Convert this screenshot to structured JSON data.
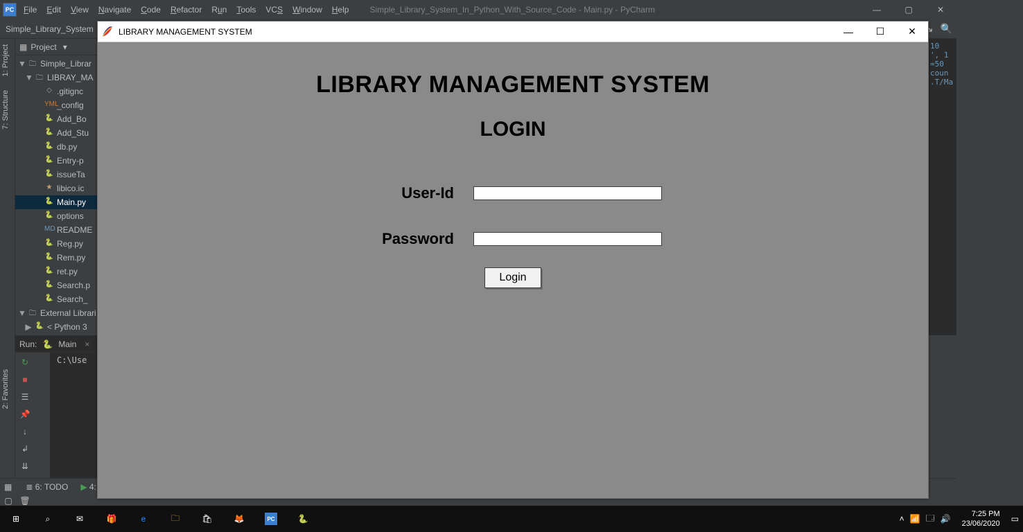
{
  "pycharm": {
    "menu": [
      "File",
      "Edit",
      "View",
      "Navigate",
      "Code",
      "Refactor",
      "Run",
      "Tools",
      "VCS",
      "Window",
      "Help"
    ],
    "window_title": "Simple_Library_System_In_Python_With_Source_Code - Main.py - PyCharm",
    "navbar_crumb": "Simple_Library_System",
    "project": {
      "header": "Project",
      "tree": [
        {
          "depth": 0,
          "exp": "▼",
          "icon": "fld",
          "label": "Simple_Librar"
        },
        {
          "depth": 1,
          "exp": "▼",
          "icon": "fld",
          "label": "LIBRAY_MA"
        },
        {
          "depth": 2,
          "exp": "",
          "icon": "txt",
          "label": ".gitignc"
        },
        {
          "depth": 2,
          "exp": "",
          "icon": "yml",
          "label": "_config"
        },
        {
          "depth": 2,
          "exp": "",
          "icon": "py",
          "label": "Add_Bo"
        },
        {
          "depth": 2,
          "exp": "",
          "icon": "py",
          "label": "Add_Stu"
        },
        {
          "depth": 2,
          "exp": "",
          "icon": "py",
          "label": "db.py"
        },
        {
          "depth": 2,
          "exp": "",
          "icon": "py",
          "label": "Entry-p"
        },
        {
          "depth": 2,
          "exp": "",
          "icon": "py",
          "label": "issueTa"
        },
        {
          "depth": 2,
          "exp": "",
          "icon": "ico",
          "label": "libico.ic"
        },
        {
          "depth": 2,
          "exp": "",
          "icon": "py",
          "label": "Main.py",
          "sel": true
        },
        {
          "depth": 2,
          "exp": "",
          "icon": "py",
          "label": "options"
        },
        {
          "depth": 2,
          "exp": "",
          "icon": "md",
          "label": "README"
        },
        {
          "depth": 2,
          "exp": "",
          "icon": "py",
          "label": "Reg.py"
        },
        {
          "depth": 2,
          "exp": "",
          "icon": "py",
          "label": "Rem.py"
        },
        {
          "depth": 2,
          "exp": "",
          "icon": "py",
          "label": "ret.py"
        },
        {
          "depth": 2,
          "exp": "",
          "icon": "py",
          "label": "Search.p"
        },
        {
          "depth": 2,
          "exp": "",
          "icon": "py",
          "label": "Search_"
        },
        {
          "depth": 0,
          "exp": "▼",
          "icon": "fld",
          "label": "External Librari"
        },
        {
          "depth": 1,
          "exp": "▶",
          "icon": "py",
          "label": "< Python 3"
        }
      ]
    },
    "side_tabs_top": [
      "1: Project",
      "7: Structure"
    ],
    "side_tabs_bottom": [
      "2: Favorites"
    ],
    "run": {
      "label": "Run:",
      "config": "Main",
      "console_line": "C:\\Use"
    },
    "statusbar": {
      "todo": "6: TODO",
      "run": "4:"
    },
    "editor_sliver": [
      "",
      "",
      "",
      "10",
      "",
      "",
      "",
      "', 1",
      "",
      "",
      "=50",
      "coun",
      "",
      ".T/Ma"
    ]
  },
  "tk": {
    "title": "LIBRARY MANAGEMENT SYSTEM",
    "heading": "LIBRARY MANAGEMENT SYSTEM",
    "subheading": "LOGIN",
    "userid_label": "User-Id",
    "password_label": "Password",
    "login_btn": "Login"
  },
  "taskbar": {
    "items": [
      "start",
      "search",
      "mail",
      "store-gift",
      "edge",
      "file-explorer",
      "ms-store",
      "firefox",
      "pycharm",
      "python"
    ],
    "tray": {
      "time": "7:25 PM",
      "date": "23/06/2020"
    }
  }
}
